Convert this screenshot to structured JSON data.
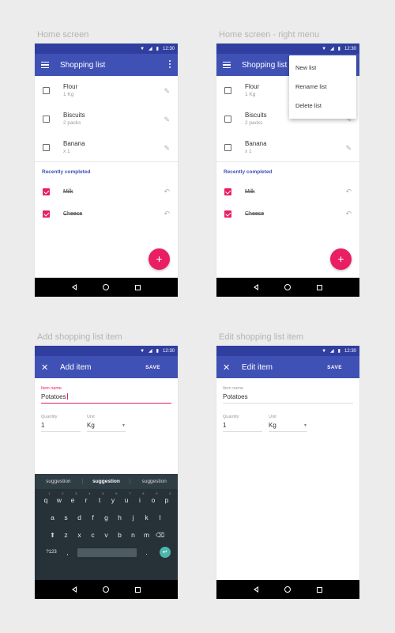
{
  "captions": {
    "home": "Home screen",
    "home_menu": "Home screen - right menu",
    "add": "Add shopping list item",
    "edit": "Edit shopping list item"
  },
  "status": {
    "time": "12:30"
  },
  "colors": {
    "primary": "#3f51b5",
    "primary_dark": "#303f9f",
    "accent": "#e91e63"
  },
  "home": {
    "title": "Shopping list",
    "items": [
      {
        "name": "Flour",
        "qty": "1 Kg"
      },
      {
        "name": "Biscuits",
        "qty": "2 packs"
      },
      {
        "name": "Banana",
        "qty": "x 1"
      }
    ],
    "section": "Recently completed",
    "completed": [
      "Milk",
      "Cheese"
    ],
    "fab": "+"
  },
  "menu": {
    "items": [
      "New list",
      "Rename list",
      "Delete list"
    ]
  },
  "add": {
    "title": "Add item",
    "save": "SAVE",
    "item_label": "Item name",
    "item_value": "Potatoes",
    "qty_label": "Quantity",
    "qty_value": "1",
    "unit_label": "Unit",
    "unit_value": "Kg"
  },
  "edit": {
    "title": "Edit item",
    "save": "SAVE",
    "item_label": "Item name",
    "item_value": "Potatoes",
    "qty_label": "Quantity",
    "qty_value": "1",
    "unit_label": "Unit",
    "unit_value": "Kg"
  },
  "keyboard": {
    "suggestions": [
      "suggestion",
      "suggestion",
      "suggestion"
    ],
    "row1": [
      "q",
      "w",
      "e",
      "r",
      "t",
      "y",
      "u",
      "i",
      "o",
      "p"
    ],
    "row1_hints": [
      "1",
      "2",
      "3",
      "4",
      "5",
      "6",
      "7",
      "8",
      "9",
      "0"
    ],
    "row2": [
      "a",
      "s",
      "d",
      "f",
      "g",
      "h",
      "j",
      "k",
      "l"
    ],
    "row3": [
      "z",
      "x",
      "c",
      "v",
      "b",
      "n",
      "m"
    ],
    "symbols": "?123",
    "comma": ",",
    "period": "."
  }
}
